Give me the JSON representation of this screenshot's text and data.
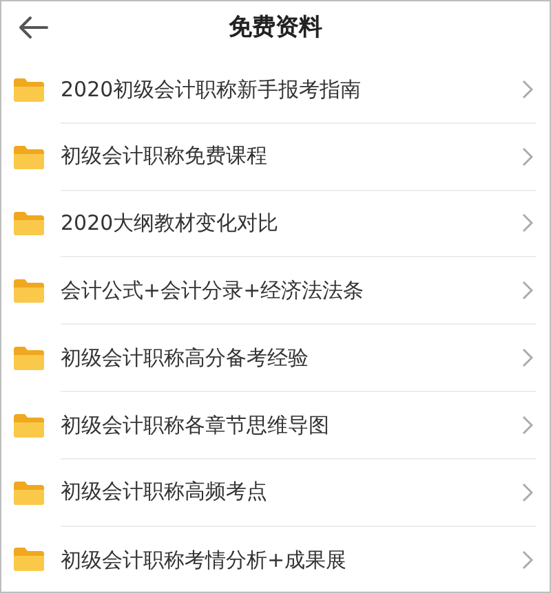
{
  "header": {
    "title": "免费资料"
  },
  "items": [
    {
      "label": "2020初级会计职称新手报考指南"
    },
    {
      "label": "初级会计职称免费课程"
    },
    {
      "label": "2020大纲教材变化对比"
    },
    {
      "label": "会计公式+会计分录+经济法法条"
    },
    {
      "label": "初级会计职称高分备考经验"
    },
    {
      "label": "初级会计职称各章节思维导图"
    },
    {
      "label": "初级会计职称高频考点"
    },
    {
      "label": "初级会计职称考情分析+成果展"
    }
  ]
}
